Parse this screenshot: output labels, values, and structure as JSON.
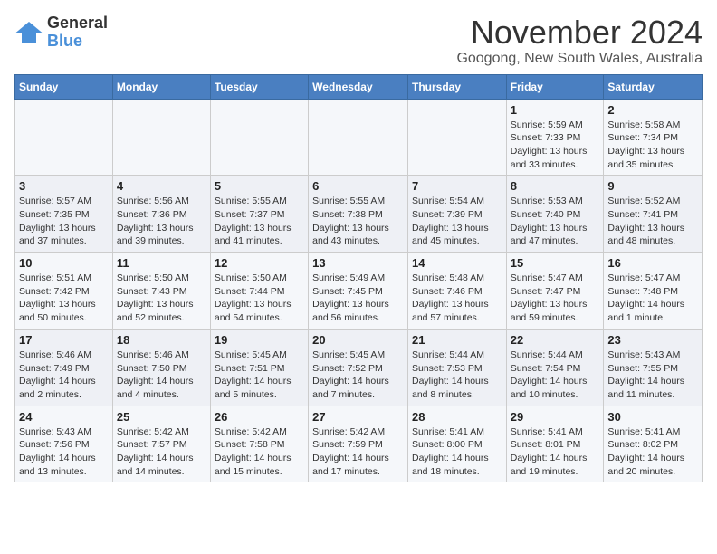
{
  "logo": {
    "text_general": "General",
    "text_blue": "Blue"
  },
  "header": {
    "month_title": "November 2024",
    "location": "Googong, New South Wales, Australia"
  },
  "days_of_week": [
    "Sunday",
    "Monday",
    "Tuesday",
    "Wednesday",
    "Thursday",
    "Friday",
    "Saturday"
  ],
  "weeks": [
    [
      {
        "day": "",
        "sunrise": "",
        "sunset": "",
        "daylight": ""
      },
      {
        "day": "",
        "sunrise": "",
        "sunset": "",
        "daylight": ""
      },
      {
        "day": "",
        "sunrise": "",
        "sunset": "",
        "daylight": ""
      },
      {
        "day": "",
        "sunrise": "",
        "sunset": "",
        "daylight": ""
      },
      {
        "day": "",
        "sunrise": "",
        "sunset": "",
        "daylight": ""
      },
      {
        "day": "1",
        "sunrise": "5:59 AM",
        "sunset": "7:33 PM",
        "daylight": "13 hours and 33 minutes."
      },
      {
        "day": "2",
        "sunrise": "5:58 AM",
        "sunset": "7:34 PM",
        "daylight": "13 hours and 35 minutes."
      }
    ],
    [
      {
        "day": "3",
        "sunrise": "5:57 AM",
        "sunset": "7:35 PM",
        "daylight": "13 hours and 37 minutes."
      },
      {
        "day": "4",
        "sunrise": "5:56 AM",
        "sunset": "7:36 PM",
        "daylight": "13 hours and 39 minutes."
      },
      {
        "day": "5",
        "sunrise": "5:55 AM",
        "sunset": "7:37 PM",
        "daylight": "13 hours and 41 minutes."
      },
      {
        "day": "6",
        "sunrise": "5:55 AM",
        "sunset": "7:38 PM",
        "daylight": "13 hours and 43 minutes."
      },
      {
        "day": "7",
        "sunrise": "5:54 AM",
        "sunset": "7:39 PM",
        "daylight": "13 hours and 45 minutes."
      },
      {
        "day": "8",
        "sunrise": "5:53 AM",
        "sunset": "7:40 PM",
        "daylight": "13 hours and 47 minutes."
      },
      {
        "day": "9",
        "sunrise": "5:52 AM",
        "sunset": "7:41 PM",
        "daylight": "13 hours and 48 minutes."
      }
    ],
    [
      {
        "day": "10",
        "sunrise": "5:51 AM",
        "sunset": "7:42 PM",
        "daylight": "13 hours and 50 minutes."
      },
      {
        "day": "11",
        "sunrise": "5:50 AM",
        "sunset": "7:43 PM",
        "daylight": "13 hours and 52 minutes."
      },
      {
        "day": "12",
        "sunrise": "5:50 AM",
        "sunset": "7:44 PM",
        "daylight": "13 hours and 54 minutes."
      },
      {
        "day": "13",
        "sunrise": "5:49 AM",
        "sunset": "7:45 PM",
        "daylight": "13 hours and 56 minutes."
      },
      {
        "day": "14",
        "sunrise": "5:48 AM",
        "sunset": "7:46 PM",
        "daylight": "13 hours and 57 minutes."
      },
      {
        "day": "15",
        "sunrise": "5:47 AM",
        "sunset": "7:47 PM",
        "daylight": "13 hours and 59 minutes."
      },
      {
        "day": "16",
        "sunrise": "5:47 AM",
        "sunset": "7:48 PM",
        "daylight": "14 hours and 1 minute."
      }
    ],
    [
      {
        "day": "17",
        "sunrise": "5:46 AM",
        "sunset": "7:49 PM",
        "daylight": "14 hours and 2 minutes."
      },
      {
        "day": "18",
        "sunrise": "5:46 AM",
        "sunset": "7:50 PM",
        "daylight": "14 hours and 4 minutes."
      },
      {
        "day": "19",
        "sunrise": "5:45 AM",
        "sunset": "7:51 PM",
        "daylight": "14 hours and 5 minutes."
      },
      {
        "day": "20",
        "sunrise": "5:45 AM",
        "sunset": "7:52 PM",
        "daylight": "14 hours and 7 minutes."
      },
      {
        "day": "21",
        "sunrise": "5:44 AM",
        "sunset": "7:53 PM",
        "daylight": "14 hours and 8 minutes."
      },
      {
        "day": "22",
        "sunrise": "5:44 AM",
        "sunset": "7:54 PM",
        "daylight": "14 hours and 10 minutes."
      },
      {
        "day": "23",
        "sunrise": "5:43 AM",
        "sunset": "7:55 PM",
        "daylight": "14 hours and 11 minutes."
      }
    ],
    [
      {
        "day": "24",
        "sunrise": "5:43 AM",
        "sunset": "7:56 PM",
        "daylight": "14 hours and 13 minutes."
      },
      {
        "day": "25",
        "sunrise": "5:42 AM",
        "sunset": "7:57 PM",
        "daylight": "14 hours and 14 minutes."
      },
      {
        "day": "26",
        "sunrise": "5:42 AM",
        "sunset": "7:58 PM",
        "daylight": "14 hours and 15 minutes."
      },
      {
        "day": "27",
        "sunrise": "5:42 AM",
        "sunset": "7:59 PM",
        "daylight": "14 hours and 17 minutes."
      },
      {
        "day": "28",
        "sunrise": "5:41 AM",
        "sunset": "8:00 PM",
        "daylight": "14 hours and 18 minutes."
      },
      {
        "day": "29",
        "sunrise": "5:41 AM",
        "sunset": "8:01 PM",
        "daylight": "14 hours and 19 minutes."
      },
      {
        "day": "30",
        "sunrise": "5:41 AM",
        "sunset": "8:02 PM",
        "daylight": "14 hours and 20 minutes."
      }
    ]
  ]
}
